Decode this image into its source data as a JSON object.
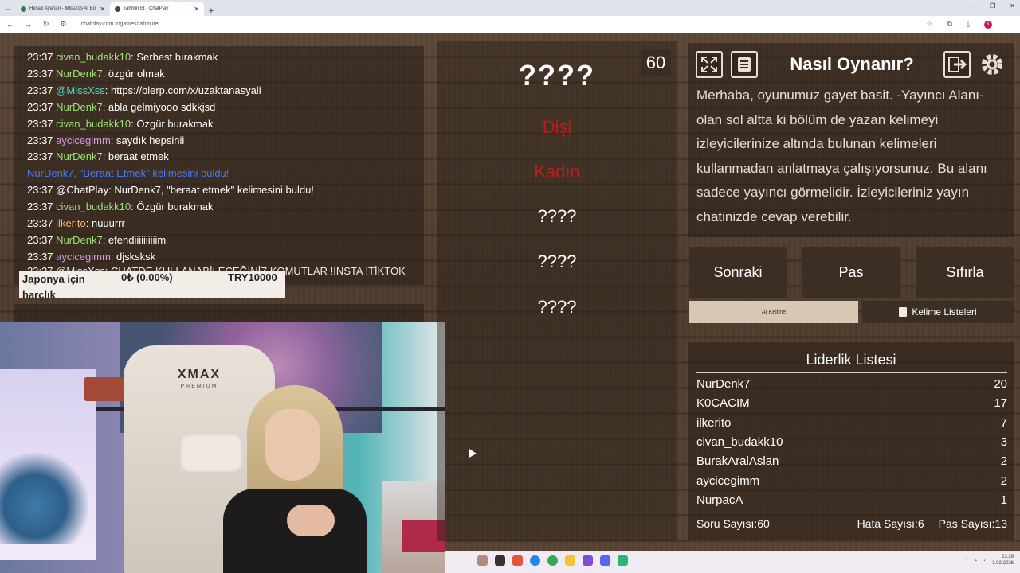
{
  "browser": {
    "tabs": [
      {
        "title": "Hesap Ayarları - MissXss AI Bot"
      },
      {
        "title": "Tahmin Et - ChatPlay"
      }
    ],
    "url": "chatplay.com.tr/games/tahminet"
  },
  "chat": {
    "messages": [
      {
        "time": "23:37",
        "user": "civan_budakk10",
        "color": "green",
        "text": ": Serbest bırakmak"
      },
      {
        "time": "23:37",
        "user": "NurDenk7",
        "color": "green",
        "text": ": özgür olmak"
      },
      {
        "time": "23:37",
        "user": "@MissXss",
        "color": "teal",
        "text": ": https://blerp.com/x/uzaktanasyali"
      },
      {
        "time": "23:37",
        "user": "NurDenk7",
        "color": "green",
        "text": ": abla gelmiyooo sdkkjsd"
      },
      {
        "time": "23:37",
        "user": "civan_budakk10",
        "color": "green",
        "text": ": Özgür burakmak"
      },
      {
        "time": "23:37",
        "user": "aycicegimm",
        "color": "pink",
        "text": ": saydık hepsinii"
      },
      {
        "time": "23:37",
        "user": "NurDenk7",
        "color": "green",
        "text": ": beraat etmek"
      },
      {
        "time": "",
        "user": "",
        "color": "found",
        "text": "NurDenk7, \"Beraat Etmek\" kelimesini buldu!"
      },
      {
        "time": "23:37",
        "user": "@ChatPlay",
        "color": "white",
        "text": ": NurDenk7, \"beraat etmek\" kelimesini buldu!"
      },
      {
        "time": "23:37",
        "user": "civan_budakk10",
        "color": "green",
        "text": ": Özgür burakmak"
      },
      {
        "time": "23:37",
        "user": "ilkerito",
        "color": "orange",
        "text": ": nuuurrr"
      },
      {
        "time": "23:37",
        "user": "NurDenk7",
        "color": "green",
        "text": ": efendiiiiiiiiiim"
      },
      {
        "time": "23:37",
        "user": "aycicegimm",
        "color": "pink",
        "text": ": djsksksk"
      }
    ],
    "overflow_line": "23:37 @MissXss: CHATDE KULLANABİLECEĞİNİZ KOMUTLAR !INSTA !TİKTOK"
  },
  "donation": {
    "title": "Japonya için harçlık",
    "amount": "0₺ (0.00%)",
    "goal": "TRY10000"
  },
  "webcam": {
    "chair_brand": "XMAX",
    "chair_sub": "PREMIUM"
  },
  "game": {
    "timer": "60",
    "main_word": "????",
    "forbidden_words": [
      "Dişi",
      "Kadın",
      "????",
      "????",
      "????"
    ]
  },
  "howto": {
    "title": "Nasıl Oynanır?",
    "text": "Merhaba, oyunumuz gayet basit. -Yayıncı Alanı- olan sol altta ki bölüm de yazan kelimeyi izleyicilerinize altında bulunan kelimeleri kullanmadan anlatmaya çalışıyorsunuz. Bu alanı sadece yayıncı görmelidir. İzleyicileriniz yayın chatinizde cevap verebilir."
  },
  "actions": {
    "next": "Sonraki",
    "pass": "Pas",
    "reset": "Sıfırla"
  },
  "modes": {
    "ai": "AI Kelime",
    "lists": "Kelime Listeleri"
  },
  "leaderboard": {
    "title": "Liderlik Listesi",
    "rows": [
      {
        "name": "NurDenk7",
        "score": "20"
      },
      {
        "name": "K0CACIM",
        "score": "17"
      },
      {
        "name": "ilkerito",
        "score": "7"
      },
      {
        "name": "civan_budakk10",
        "score": "3"
      },
      {
        "name": "BurakAralAslan",
        "score": "2"
      },
      {
        "name": "aycicegimm",
        "score": "2"
      },
      {
        "name": "NurpacA",
        "score": "1"
      }
    ]
  },
  "stats": {
    "questions": "Soru Sayısı:60",
    "errors": "Hata Sayısı:6",
    "passes": "Pas Sayısı:13"
  },
  "taskbar": {
    "time": "23:39",
    "date": "3.02.2026"
  }
}
